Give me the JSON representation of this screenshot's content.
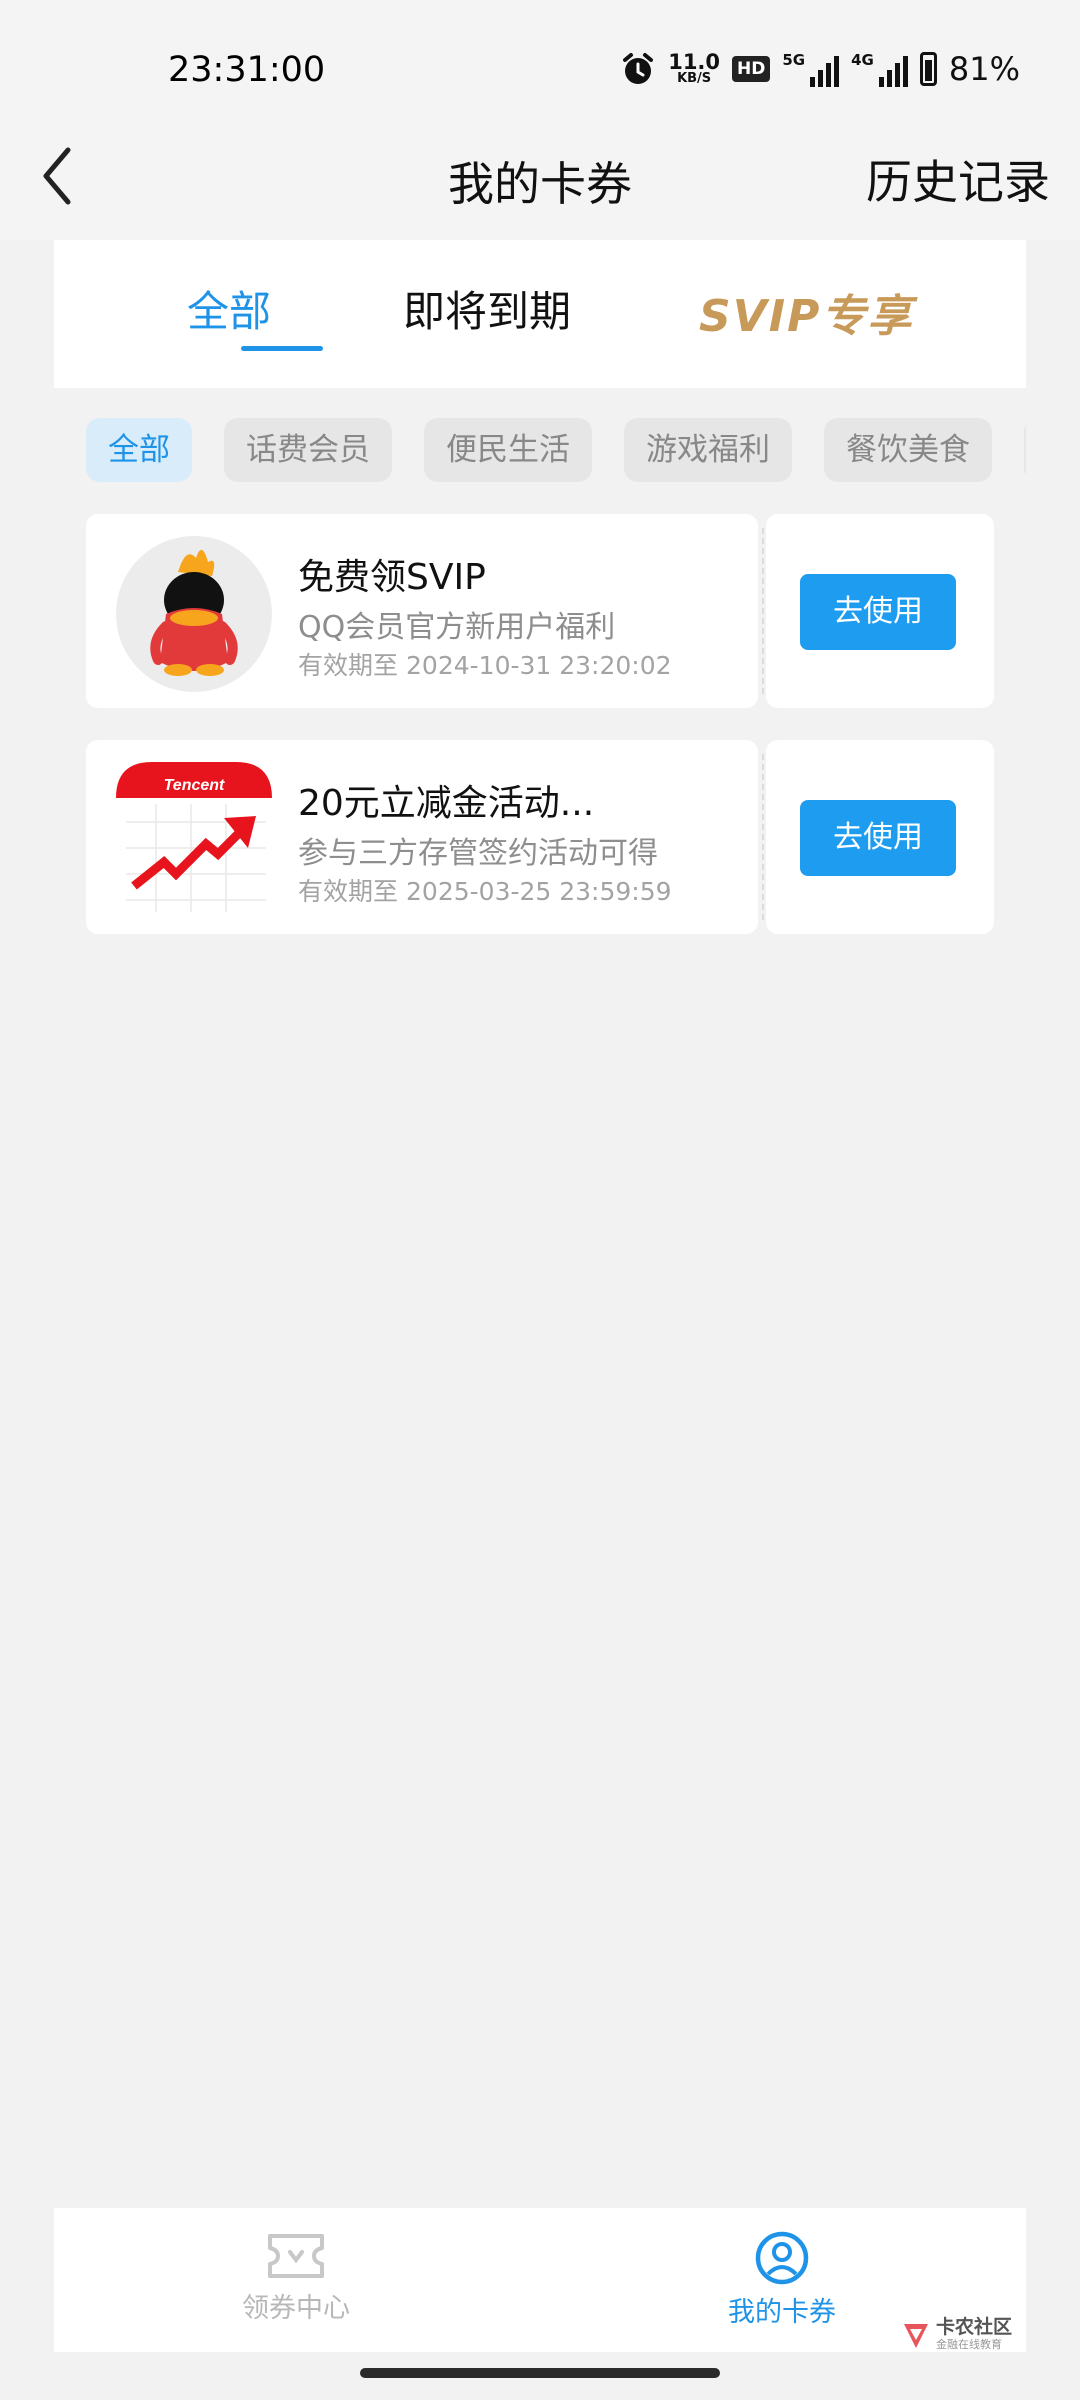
{
  "status_bar": {
    "time": "23:31:00",
    "speed_value": "11.0",
    "speed_unit": "KB/S",
    "hd_label": "HD",
    "net1": "5G",
    "net2": "4G",
    "battery": "81%"
  },
  "nav": {
    "title": "我的卡券",
    "history": "历史记录"
  },
  "tabs": [
    {
      "label": "全部",
      "active": true
    },
    {
      "label": "即将到期",
      "active": false
    },
    {
      "label": "SVIP专享",
      "active": false
    }
  ],
  "chips": [
    {
      "label": "全部",
      "active": true
    },
    {
      "label": "话费会员",
      "active": false
    },
    {
      "label": "便民生活",
      "active": false
    },
    {
      "label": "游戏福利",
      "active": false
    },
    {
      "label": "餐饮美食",
      "active": false
    },
    {
      "label": "",
      "active": false
    }
  ],
  "coupons": [
    {
      "title": "免费领SVIP",
      "desc": "QQ会员官方新用户福利",
      "expiry_label": "有效期至",
      "expiry": "2024-10-31 23:20:02",
      "button": "去使用",
      "icon": "qq-penguin-icon"
    },
    {
      "title": "20元立减金活动...",
      "desc": "参与三方存管签约活动可得",
      "expiry_label": "有效期至",
      "expiry": "2025-03-25 23:59:59",
      "button": "去使用",
      "icon": "tencent-stock-icon",
      "icon_text": "Tencent"
    }
  ],
  "bottom_nav": [
    {
      "label": "领券中心",
      "icon": "ticket-icon",
      "active": false
    },
    {
      "label": "我的卡券",
      "icon": "user-circle-icon",
      "active": true
    }
  ],
  "watermark": {
    "main": "卡农社区",
    "sub": "金融在线教育"
  },
  "colors": {
    "accent": "#1f93e8",
    "button": "#1e9cf0",
    "svip": "#c89a5a",
    "inactive": "#b8b8b8"
  }
}
